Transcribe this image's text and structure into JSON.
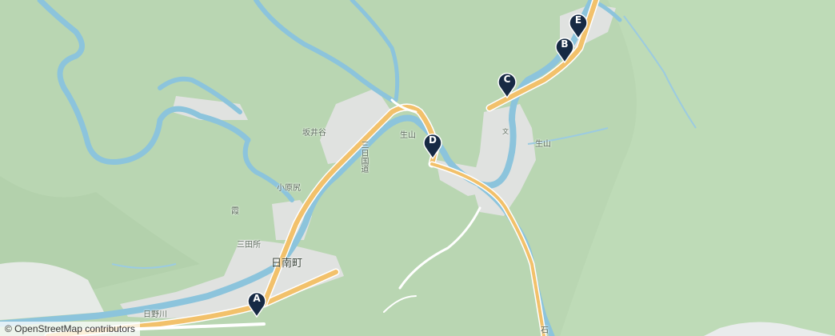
{
  "labels": {
    "nichinan": "日南町",
    "sakaidani": "坂井谷",
    "kobarajiri": "小原尻",
    "kasumi": "霞",
    "mitadokoro": "三田所",
    "ikuyama_1": "生山",
    "ikuyama_2": "生山",
    "hinogawa": "日野川",
    "route_183": "三日国道",
    "school": "文",
    "ishi": "石"
  },
  "markers": [
    {
      "letter": "A"
    },
    {
      "letter": "B"
    },
    {
      "letter": "C"
    },
    {
      "letter": "D"
    },
    {
      "letter": "E"
    }
  ],
  "attribution": "© OpenStreetMap contributors",
  "colors": {
    "forest": "#b9d6b2",
    "water": "#8cc4dc",
    "road": "#f2c16b",
    "urban": "#e3e3e3",
    "marker": "#172a44"
  }
}
